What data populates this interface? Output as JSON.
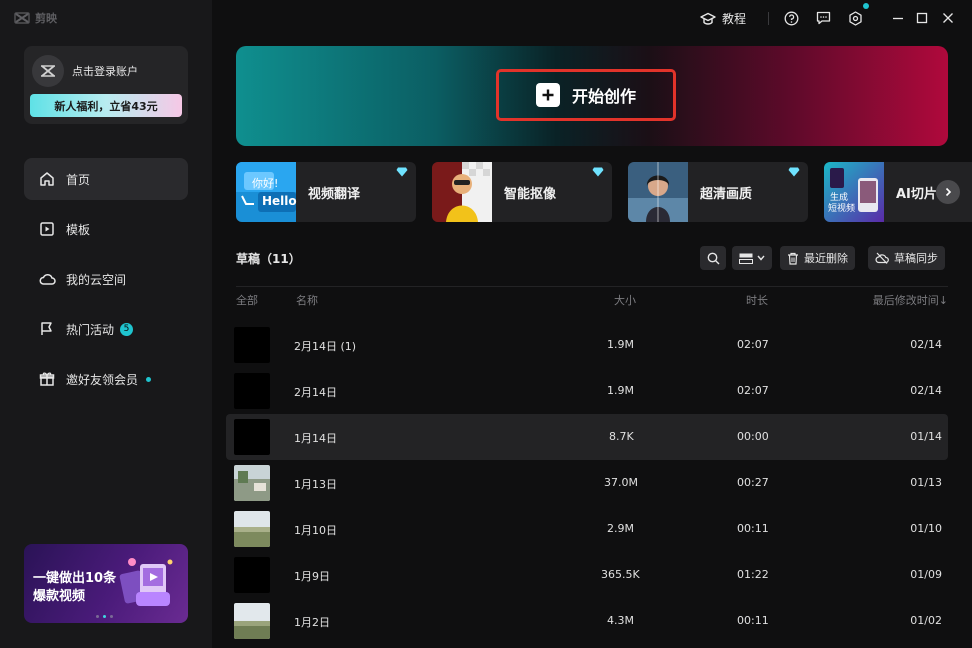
{
  "app": {
    "name": "剪映"
  },
  "account": {
    "login_text": "点击登录账户",
    "promo": "新人福利，立省43元"
  },
  "nav": {
    "items": [
      {
        "label": "首页",
        "icon": "home-icon",
        "active": true
      },
      {
        "label": "模板",
        "icon": "template-icon",
        "active": false
      },
      {
        "label": "我的云空间",
        "icon": "cloud-icon",
        "active": false
      },
      {
        "label": "热门活动",
        "icon": "flag-icon",
        "active": false,
        "badge": "5"
      },
      {
        "label": "邀好友领会员",
        "icon": "gift-icon",
        "active": false,
        "dot": true
      }
    ]
  },
  "side_banner": {
    "line1": "一键做出10条",
    "line2": "爆款视频"
  },
  "titlebar": {
    "tutorial": "教程"
  },
  "hero": {
    "create_label": "开始创作"
  },
  "features": [
    {
      "label": "视频翻译",
      "thumb_text_1": "你好!",
      "thumb_text_2": "Hello"
    },
    {
      "label": "智能抠像"
    },
    {
      "label": "超清画质"
    },
    {
      "label": "AI切片",
      "thumb_text_1": "生成",
      "thumb_text_2": "短视频"
    }
  ],
  "drafts": {
    "title": "草稿（11）",
    "recent_delete": "最近删除",
    "sync": "草稿同步",
    "columns": {
      "all": "全部",
      "name": "名称",
      "size": "大小",
      "duration": "时长",
      "modified": "最后修改时间↓"
    },
    "rows": [
      {
        "name": "2月14日 (1)",
        "size": "1.9M",
        "duration": "02:07",
        "modified": "02/14",
        "thumb": "black"
      },
      {
        "name": "2月14日",
        "size": "1.9M",
        "duration": "02:07",
        "modified": "02/14",
        "thumb": "black"
      },
      {
        "name": "1月14日",
        "size": "8.7K",
        "duration": "00:00",
        "modified": "01/14",
        "thumb": "black",
        "highlighted": true
      },
      {
        "name": "1月13日",
        "size": "37.0M",
        "duration": "00:27",
        "modified": "01/13",
        "thumb": "landscape"
      },
      {
        "name": "1月10日",
        "size": "2.9M",
        "duration": "00:11",
        "modified": "01/10",
        "thumb": "landscape"
      },
      {
        "name": "1月9日",
        "size": "365.5K",
        "duration": "01:22",
        "modified": "01/09",
        "thumb": "black"
      },
      {
        "name": "1月2日",
        "size": "4.3M",
        "duration": "00:11",
        "modified": "01/02",
        "thumb": "landscape"
      }
    ]
  },
  "colors": {
    "accent": "#1fc4cf",
    "highlight_border": "#e2332a"
  }
}
